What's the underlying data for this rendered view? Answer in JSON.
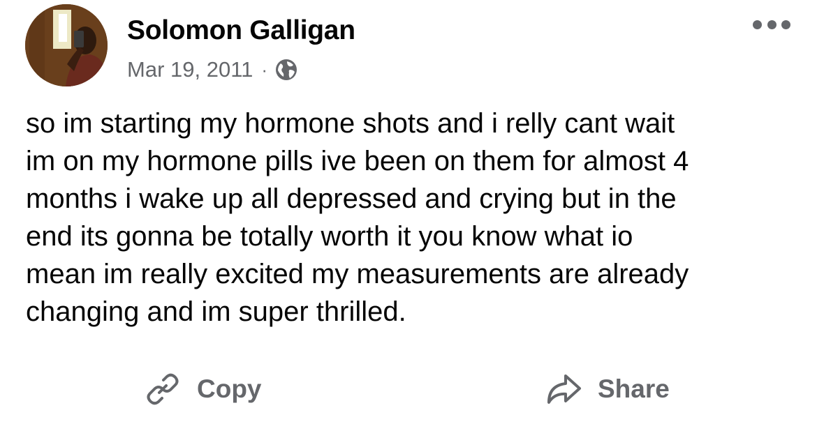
{
  "post": {
    "author": "Solomon Galligan",
    "date": "Mar 19, 2011",
    "separator": "·",
    "privacy_icon": "globe-icon",
    "more_icon": "more-horizontal-icon",
    "text": "so im starting my hormone shots and i relly cant wait\nim on my hormone pills ive been on them for almost 4\nmonths i wake up all depressed and crying but in the\nend its gonna be totally worth it you know what io\nmean im really excited my measurements are already\nchanging and im super thrilled."
  },
  "actions": {
    "copy_label": "Copy",
    "copy_icon": "link-icon",
    "share_label": "Share",
    "share_icon": "share-arrow-icon"
  },
  "colors": {
    "text_primary": "#050505",
    "text_secondary": "#65676b",
    "background": "#ffffff"
  }
}
